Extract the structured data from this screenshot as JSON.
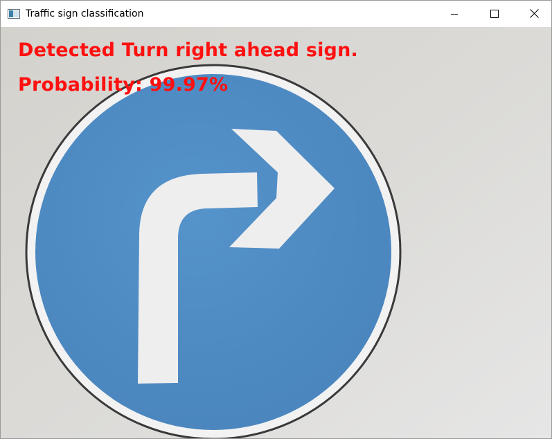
{
  "window": {
    "title": "Traffic sign classification",
    "app_icon": "opencv-window-icon",
    "controls": {
      "minimize_icon": "minimize-icon",
      "maximize_icon": "maximize-icon",
      "close_icon": "close-icon"
    }
  },
  "frame": {
    "overlay": {
      "line1": "Detected Turn right ahead sign.",
      "line2": "Probability: 99.97%"
    },
    "colors": {
      "overlay_text": "#ff1010",
      "sign_blue": "#4e8bc4",
      "arrow_white": "#eeeeee",
      "background": "#d9d8d4"
    }
  }
}
